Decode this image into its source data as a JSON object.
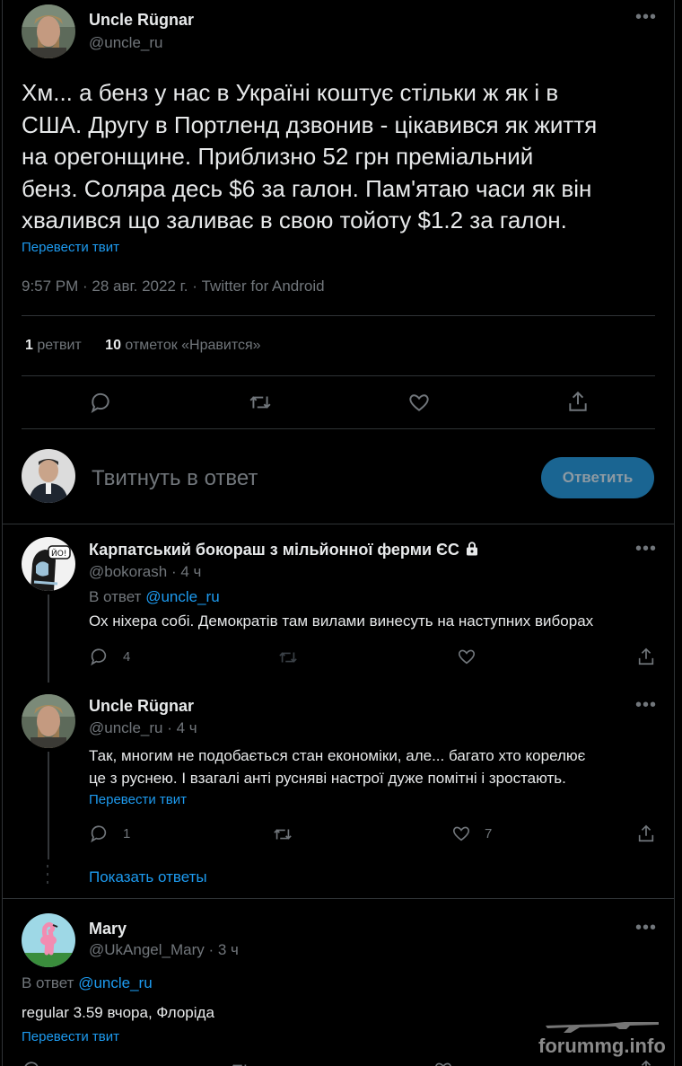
{
  "main_tweet": {
    "author_name": "Uncle Rügnar",
    "author_handle": "@uncle_ru",
    "text_lines": [
      "Хм... а бенз у нас в Україні коштує стільки ж як і в",
      "США. Другу в Портленд дзвонив - цікавився як життя",
      "на орегонщине. Приблизно 52 грн преміальний",
      "бенз. Соляра десь $6 за галон. Пам'ятаю часи як він",
      "хвалився що заливає в свою тойоту $1.2 за галон."
    ],
    "translate_label": "Перевести твит",
    "meta": "9:57 PM · 28 авг. 2022 г. · Twitter for Android",
    "retweets_count": "1",
    "retweets_label": "ретвит",
    "likes_count": "10",
    "likes_label": "отметок «Нравится»"
  },
  "reply_box": {
    "placeholder": "Твитнуть в ответ",
    "button_label": "Ответить"
  },
  "replies": [
    {
      "author_name": "Карпатський бокораш з мільйонної ферми ЄС",
      "author_handle": "@bokorash",
      "time": "· 4 ч",
      "reply_to_prefix": "В ответ",
      "reply_to_handle": "@uncle_ru",
      "text_lines": [
        "Ох ніхера собі. Демократів там вилами винесуть на наступних виборах"
      ],
      "reply_count": "4",
      "retweet_count": "",
      "like_count": ""
    },
    {
      "author_name": "Uncle Rügnar",
      "author_handle": "@uncle_ru",
      "time": "· 4 ч",
      "text_lines": [
        "Так, многим не подобається стан економіки, але... багато хто корелює",
        "це з руснею. І взагалі анті русняві настрої дуже помітні і зростають."
      ],
      "translate_label": "Перевести твит",
      "reply_count": "1",
      "retweet_count": "",
      "like_count": "7"
    },
    {
      "author_name": "Mary",
      "author_handle": "@UkAngel_Mary",
      "time": "· 3 ч",
      "reply_to_prefix": "В ответ",
      "reply_to_handle": "@uncle_ru",
      "text_lines": [
        "regular 3.59 вчора, Флоріда"
      ],
      "translate_label": "Перевести твит"
    }
  ],
  "show_replies_label": "Показать ответы",
  "watermark_text": "forummg.info",
  "colors": {
    "accent": "#1d9bf0",
    "reply_button_bg": "#1a6592",
    "secondary_text": "#71767b",
    "border": "#2f3336"
  }
}
